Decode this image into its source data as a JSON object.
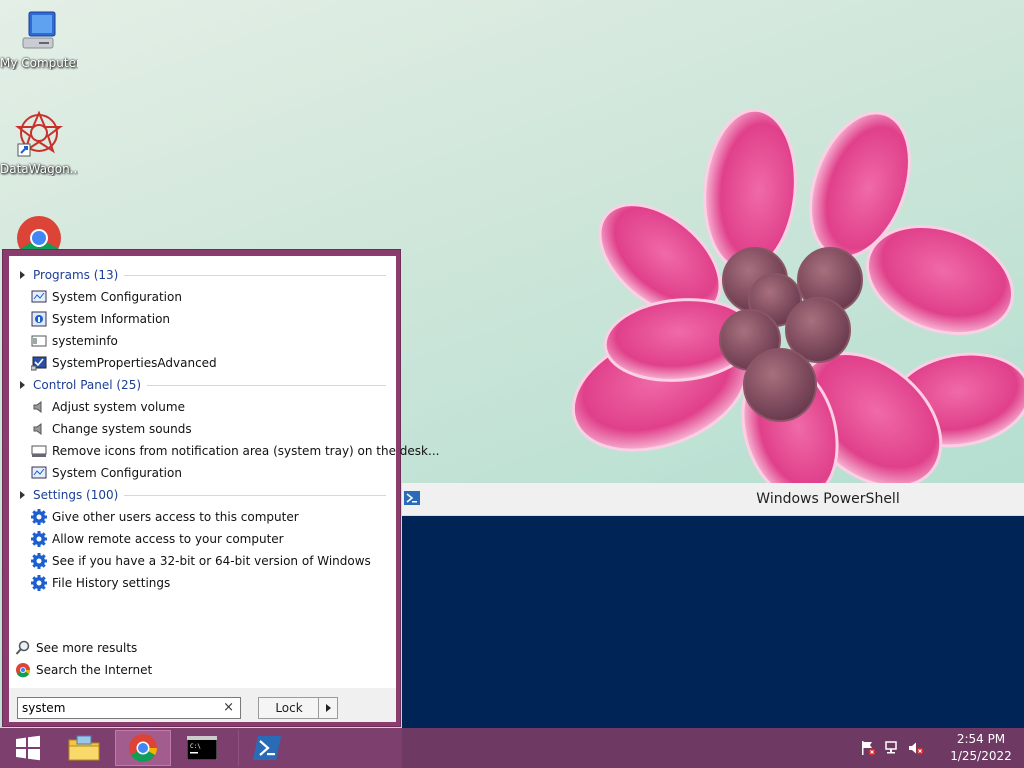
{
  "desktop": {
    "icons": [
      {
        "label": "My Computer",
        "icon": "computer-icon"
      },
      {
        "label": "DataWagon...",
        "icon": "datawagon-icon"
      },
      {
        "label": "",
        "icon": "chrome-icon"
      }
    ]
  },
  "powershell_window": {
    "title": "Windows PowerShell",
    "icon": "powershell-icon",
    "bg": "#012456"
  },
  "start_menu": {
    "groups": [
      {
        "label": "Programs (13)",
        "items": [
          {
            "label": "System Configuration",
            "icon": "msconfig-icon"
          },
          {
            "label": "System Information",
            "icon": "sysinfo-icon"
          },
          {
            "label": "systeminfo",
            "icon": "console-app-icon"
          },
          {
            "label": "SystemPropertiesAdvanced",
            "icon": "system-properties-icon"
          }
        ]
      },
      {
        "label": "Control Panel (25)",
        "items": [
          {
            "label": "Adjust system volume",
            "icon": "speaker-icon"
          },
          {
            "label": "Change system sounds",
            "icon": "speaker-icon"
          },
          {
            "label": "Remove icons from notification area (system tray) on the desk...",
            "icon": "taskbar-icon"
          },
          {
            "label": "System Configuration",
            "icon": "msconfig-icon"
          }
        ]
      },
      {
        "label": "Settings (100)",
        "items": [
          {
            "label": "Give other users access to this computer",
            "icon": "gear-icon"
          },
          {
            "label": "Allow remote access to your computer",
            "icon": "gear-icon"
          },
          {
            "label": "See if you have a 32-bit or 64-bit version of Windows",
            "icon": "gear-icon"
          },
          {
            "label": "File History settings",
            "icon": "gear-icon"
          }
        ]
      }
    ],
    "see_more": "See more results",
    "search_internet": "Search the Internet",
    "search": {
      "value": "system",
      "clear": "×"
    },
    "lock_label": "Lock",
    "accent": "#8a3c6e"
  },
  "taskbar": {
    "buttons": [
      "start-button",
      "explorer",
      "chrome",
      "cmd",
      "powershell"
    ],
    "clock": {
      "time": "2:54 PM",
      "date": "1/25/2022"
    },
    "accent": "#6e3a64"
  }
}
